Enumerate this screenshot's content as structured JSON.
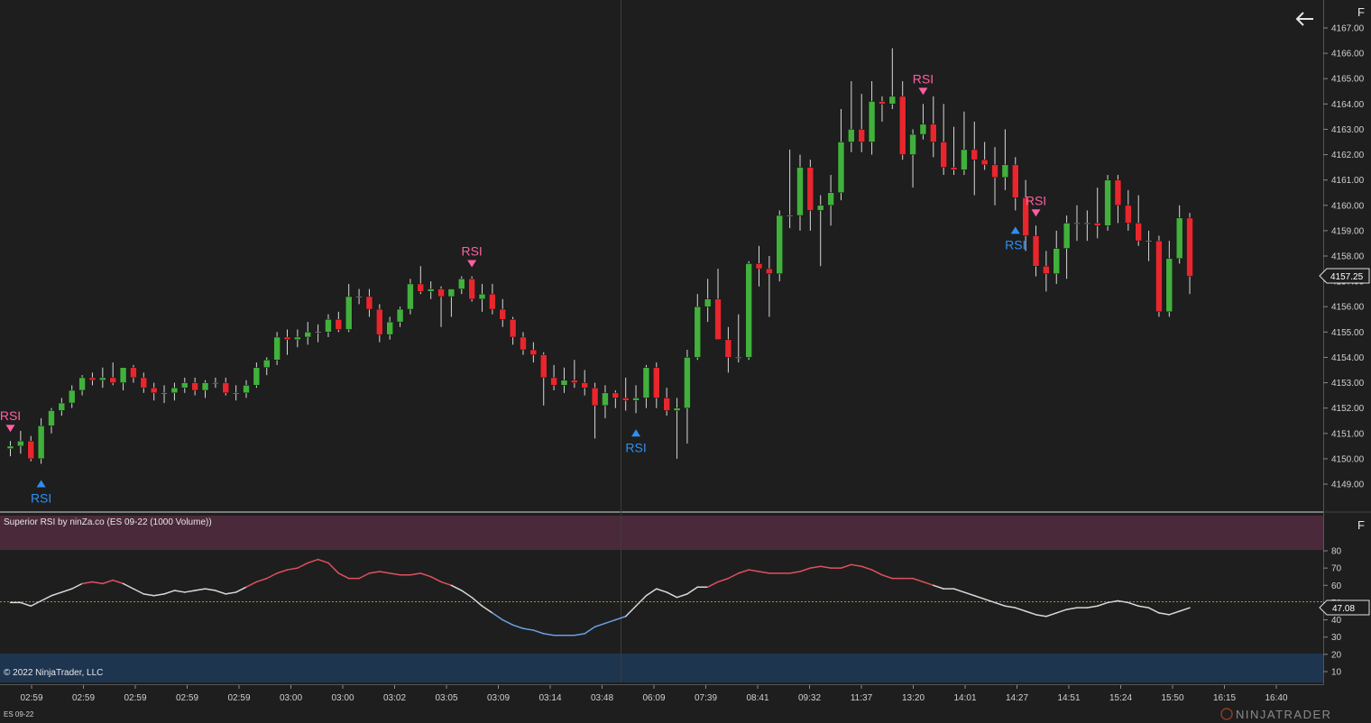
{
  "app": {
    "instrument_label": "ES 09-22",
    "copyright": "© 2022 NinjaTrader, LLC",
    "logo_text": "NINJATRADER",
    "back_icon": "arrow-left-icon",
    "panel_menu_label": "F"
  },
  "colors": {
    "background": "#1e1e1e",
    "up_candle": "#41b03c",
    "down_candle": "#e8262d",
    "wick": "#d8d8d8",
    "signal_sell": "#ff5fa2",
    "signal_buy": "#2f8ff0",
    "overbought_zone": "#4a2a3a",
    "oversold_zone": "#1e3550",
    "rsi_high": "#e05060",
    "rsi_low": "#6aa0e0",
    "rsi_mid": "#d8d8d8",
    "midline": "#c8861e",
    "axis_text": "#d0d0d0"
  },
  "price_panel": {
    "current_price": "4157.25",
    "y_ticks": [
      "4167.00",
      "4166.00",
      "4165.00",
      "4164.00",
      "4163.00",
      "4162.00",
      "4161.00",
      "4160.00",
      "4159.00",
      "4158.00",
      "4157.00",
      "4156.00",
      "4155.00",
      "4154.00",
      "4153.00",
      "4152.00",
      "4151.00",
      "4150.00",
      "4149.00"
    ],
    "signals": [
      {
        "label": "RSI",
        "type": "sell",
        "bar": 0
      },
      {
        "label": "RSI",
        "type": "buy",
        "bar": 3
      },
      {
        "label": "RSI",
        "type": "sell",
        "bar": 45
      },
      {
        "label": "RSI",
        "type": "buy",
        "bar": 61
      },
      {
        "label": "RSI",
        "type": "sell",
        "bar": 89
      },
      {
        "label": "RSI",
        "type": "buy",
        "bar": 98
      },
      {
        "label": "RSI",
        "type": "sell",
        "bar": 100
      }
    ]
  },
  "rsi_panel": {
    "title": "Superior RSI by ninZa.co (ES 09-22 (1000 Volume))",
    "current_value": "47.08",
    "y_ticks": [
      "80",
      "70",
      "60",
      "50",
      "40",
      "30",
      "20",
      "10"
    ],
    "overbought": 80,
    "oversold": 20,
    "midline": 47.08
  },
  "x_axis": {
    "labels": [
      "02:59",
      "02:59",
      "02:59",
      "02:59",
      "02:59",
      "03:00",
      "03:00",
      "03:02",
      "03:05",
      "03:09",
      "03:14",
      "03:48",
      "06:09",
      "07:39",
      "08:41",
      "09:32",
      "11:37",
      "13:20",
      "14:01",
      "14:27",
      "14:51",
      "15:24",
      "15:50",
      "16:15",
      "16:40"
    ]
  },
  "chart_data": {
    "type": "candlestick",
    "instrument": "ES 09-22 (1000 Volume)",
    "ohlc": [
      [
        4150.4,
        4150.7,
        4150.1,
        4150.5
      ],
      [
        4150.5,
        4151.1,
        4150.2,
        4150.7
      ],
      [
        4150.7,
        4150.9,
        4149.9,
        4150.0
      ],
      [
        4150.0,
        4151.6,
        4149.8,
        4151.3
      ],
      [
        4151.3,
        4152.0,
        4151.0,
        4151.9
      ],
      [
        4151.9,
        4152.4,
        4151.7,
        4152.2
      ],
      [
        4152.2,
        4152.9,
        4152.0,
        4152.7
      ],
      [
        4152.7,
        4153.3,
        4152.5,
        4153.2
      ],
      [
        4153.2,
        4153.4,
        4152.9,
        4153.1
      ],
      [
        4153.1,
        4153.6,
        4152.8,
        4153.2
      ],
      [
        4153.2,
        4153.8,
        4152.9,
        4153.0
      ],
      [
        4153.0,
        4153.6,
        4152.7,
        4153.6
      ],
      [
        4153.6,
        4153.7,
        4153.0,
        4153.2
      ],
      [
        4153.2,
        4153.4,
        4152.6,
        4152.8
      ],
      [
        4152.8,
        4153.0,
        4152.3,
        4152.6
      ],
      [
        4152.6,
        4152.9,
        4152.2,
        4152.6
      ],
      [
        4152.6,
        4153.0,
        4152.3,
        4152.8
      ],
      [
        4152.8,
        4153.2,
        4152.6,
        4153.0
      ],
      [
        4153.0,
        4153.2,
        4152.5,
        4152.7
      ],
      [
        4152.7,
        4153.1,
        4152.4,
        4153.0
      ],
      [
        4153.0,
        4153.2,
        4152.8,
        4153.0
      ],
      [
        4153.0,
        4153.2,
        4152.5,
        4152.6
      ],
      [
        4152.6,
        4152.9,
        4152.3,
        4152.6
      ],
      [
        4152.6,
        4153.1,
        4152.4,
        4152.9
      ],
      [
        4152.9,
        4153.8,
        4152.8,
        4153.6
      ],
      [
        4153.6,
        4154.0,
        4153.3,
        4153.9
      ],
      [
        4153.9,
        4155.0,
        4153.7,
        4154.8
      ],
      [
        4154.8,
        4155.1,
        4154.1,
        4154.7
      ],
      [
        4154.7,
        4155.1,
        4154.4,
        4154.8
      ],
      [
        4154.8,
        4155.4,
        4154.5,
        4155.0
      ],
      [
        4155.0,
        4155.3,
        4154.6,
        4155.0
      ],
      [
        4155.0,
        4155.7,
        4154.8,
        4155.5
      ],
      [
        4155.5,
        4155.8,
        4155.0,
        4155.1
      ],
      [
        4155.1,
        4156.9,
        4155.0,
        4156.4
      ],
      [
        4156.4,
        4156.7,
        4156.1,
        4156.4
      ],
      [
        4156.4,
        4156.7,
        4155.6,
        4155.9
      ],
      [
        4155.9,
        4156.1,
        4154.6,
        4154.9
      ],
      [
        4154.9,
        4155.6,
        4154.7,
        4155.4
      ],
      [
        4155.4,
        4156.0,
        4155.2,
        4155.9
      ],
      [
        4155.9,
        4157.1,
        4155.7,
        4156.9
      ],
      [
        4156.9,
        4157.6,
        4156.5,
        4156.6
      ],
      [
        4156.6,
        4157.0,
        4156.3,
        4156.7
      ],
      [
        4156.7,
        4156.8,
        4155.2,
        4156.4
      ],
      [
        4156.4,
        4156.7,
        4155.6,
        4156.7
      ],
      [
        4156.7,
        4157.2,
        4156.5,
        4157.1
      ],
      [
        4157.1,
        4157.2,
        4156.2,
        4156.3
      ],
      [
        4156.3,
        4156.9,
        4155.8,
        4156.5
      ],
      [
        4156.5,
        4156.9,
        4155.7,
        4155.9
      ],
      [
        4155.9,
        4156.3,
        4155.2,
        4155.5
      ],
      [
        4155.5,
        4155.6,
        4154.5,
        4154.8
      ],
      [
        4154.8,
        4155.0,
        4154.1,
        4154.3
      ],
      [
        4154.3,
        4154.6,
        4153.8,
        4154.1
      ],
      [
        4154.1,
        4154.2,
        4152.1,
        4153.2
      ],
      [
        4153.2,
        4153.7,
        4152.7,
        4152.9
      ],
      [
        4152.9,
        4153.6,
        4152.6,
        4153.1
      ],
      [
        4153.1,
        4153.9,
        4152.8,
        4153.0
      ],
      [
        4153.0,
        4153.5,
        4152.5,
        4152.8
      ],
      [
        4152.8,
        4153.0,
        4150.8,
        4152.1
      ],
      [
        4152.1,
        4152.9,
        4151.6,
        4152.6
      ],
      [
        4152.6,
        4152.7,
        4152.0,
        4152.4
      ],
      [
        4152.4,
        4153.2,
        4151.9,
        4152.3
      ],
      [
        4152.3,
        4152.9,
        4151.8,
        4152.4
      ],
      [
        4152.4,
        4153.7,
        4152.0,
        4153.6
      ],
      [
        4153.6,
        4153.8,
        4152.0,
        4152.4
      ],
      [
        4152.4,
        4152.8,
        4151.7,
        4151.9
      ],
      [
        4151.9,
        4152.4,
        4150.0,
        4152.0
      ],
      [
        4152.0,
        4154.3,
        4150.6,
        4154.0
      ],
      [
        4154.0,
        4156.5,
        4153.9,
        4156.0
      ],
      [
        4156.0,
        4157.1,
        4155.4,
        4156.3
      ],
      [
        4156.3,
        4157.5,
        4155.2,
        4154.7
      ],
      [
        4154.7,
        4155.2,
        4153.4,
        4154.0
      ],
      [
        4154.0,
        4155.7,
        4153.8,
        4154.0
      ],
      [
        4154.0,
        4157.8,
        4153.9,
        4157.7
      ],
      [
        4157.7,
        4158.4,
        4156.8,
        4157.5
      ],
      [
        4157.5,
        4158.0,
        4155.6,
        4157.3
      ],
      [
        4157.3,
        4159.8,
        4157.0,
        4159.6
      ],
      [
        4159.6,
        4162.2,
        4159.1,
        4159.6
      ],
      [
        4159.6,
        4162.0,
        4159.0,
        4161.5
      ],
      [
        4161.5,
        4161.8,
        4159.0,
        4159.8
      ],
      [
        4159.8,
        4160.4,
        4157.6,
        4160.0
      ],
      [
        4160.0,
        4161.2,
        4159.2,
        4160.5
      ],
      [
        4160.5,
        4163.8,
        4160.2,
        4162.5
      ],
      [
        4162.5,
        4164.9,
        4162.1,
        4163.0
      ],
      [
        4163.0,
        4164.4,
        4162.1,
        4162.5
      ],
      [
        4162.5,
        4164.9,
        4162.0,
        4164.1
      ],
      [
        4164.1,
        4164.3,
        4163.3,
        4164.0
      ],
      [
        4164.0,
        4166.2,
        4163.8,
        4164.3
      ],
      [
        4164.3,
        4164.9,
        4161.8,
        4162.0
      ],
      [
        4162.0,
        4163.0,
        4160.7,
        4162.8
      ],
      [
        4162.8,
        4164.0,
        4162.6,
        4163.2
      ],
      [
        4163.2,
        4164.3,
        4161.9,
        4162.5
      ],
      [
        4162.5,
        4164.0,
        4161.2,
        4161.5
      ],
      [
        4161.5,
        4163.1,
        4161.2,
        4161.4
      ],
      [
        4161.4,
        4163.7,
        4161.2,
        4162.2
      ],
      [
        4162.2,
        4163.3,
        4160.4,
        4161.8
      ],
      [
        4161.8,
        4162.5,
        4161.4,
        4161.6
      ],
      [
        4161.6,
        4162.3,
        4160.0,
        4161.1
      ],
      [
        4161.1,
        4163.0,
        4160.6,
        4161.6
      ],
      [
        4161.6,
        4161.9,
        4159.8,
        4160.3
      ],
      [
        4160.3,
        4161.0,
        4158.2,
        4158.8
      ],
      [
        4158.8,
        4159.2,
        4157.2,
        4157.6
      ],
      [
        4157.6,
        4158.2,
        4156.6,
        4157.3
      ],
      [
        4157.3,
        4159.0,
        4156.9,
        4158.3
      ],
      [
        4158.3,
        4159.6,
        4157.1,
        4159.3
      ],
      [
        4159.3,
        4160.0,
        4158.6,
        4159.3
      ],
      [
        4159.3,
        4159.8,
        4158.6,
        4159.3
      ],
      [
        4159.3,
        4160.7,
        4158.7,
        4159.2
      ],
      [
        4159.2,
        4161.2,
        4159.0,
        4161.0
      ],
      [
        4161.0,
        4161.2,
        4159.3,
        4160.0
      ],
      [
        4160.0,
        4160.6,
        4159.0,
        4159.3
      ],
      [
        4159.3,
        4160.4,
        4158.4,
        4158.6
      ],
      [
        4158.6,
        4159.0,
        4157.8,
        4158.6
      ],
      [
        4158.6,
        4158.8,
        4155.6,
        4155.8
      ],
      [
        4155.8,
        4158.6,
        4155.6,
        4157.9
      ],
      [
        4157.9,
        4160.0,
        4157.7,
        4159.5
      ],
      [
        4159.5,
        4159.7,
        4156.5,
        4157.2
      ]
    ],
    "rsi": [
      50,
      50,
      48,
      51,
      54,
      56,
      58,
      61,
      62,
      61,
      63,
      61,
      58,
      55,
      54,
      55,
      57,
      56,
      57,
      58,
      57,
      55,
      56,
      59,
      62,
      64,
      67,
      69,
      70,
      73,
      75,
      73,
      67,
      64,
      64,
      67,
      68,
      67,
      66,
      66,
      67,
      65,
      62,
      60,
      57,
      53,
      48,
      44,
      40,
      37,
      35,
      34,
      32,
      31,
      31,
      31,
      32,
      36,
      38,
      40,
      42,
      48,
      54,
      58,
      56,
      53,
      55,
      59,
      59,
      62,
      64,
      67,
      69,
      68,
      67,
      67,
      67,
      68,
      70,
      71,
      70,
      70,
      72,
      71,
      69,
      66,
      64,
      64,
      64,
      62,
      60,
      58,
      58,
      56,
      54,
      52,
      50,
      48,
      47,
      45,
      43,
      42,
      44,
      46,
      47,
      47,
      48,
      50,
      51,
      50,
      48,
      47,
      44,
      43,
      45,
      47
    ]
  }
}
